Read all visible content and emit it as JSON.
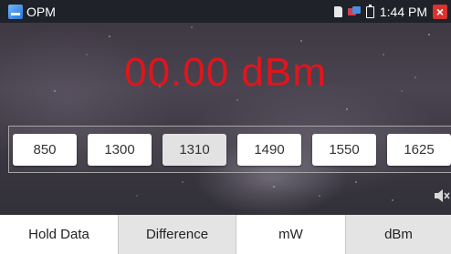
{
  "status_bar": {
    "app_title": "OPM",
    "time": "1:44 PM"
  },
  "reading": {
    "value": "00.00 dBm",
    "color": "#e0151c"
  },
  "wavelengths": {
    "items": [
      "850",
      "1300",
      "1310",
      "1490",
      "1550",
      "1625"
    ],
    "selected": "1310"
  },
  "bottom_tabs": {
    "items": [
      "Hold Data",
      "Difference",
      "mW",
      "dBm"
    ]
  },
  "icons": {
    "app": "opm-app-icon",
    "sd": "sd-card-icon",
    "network": "network-icon",
    "battery": "battery-icon",
    "close": "close-icon",
    "speaker": "speaker-mute-icon"
  }
}
